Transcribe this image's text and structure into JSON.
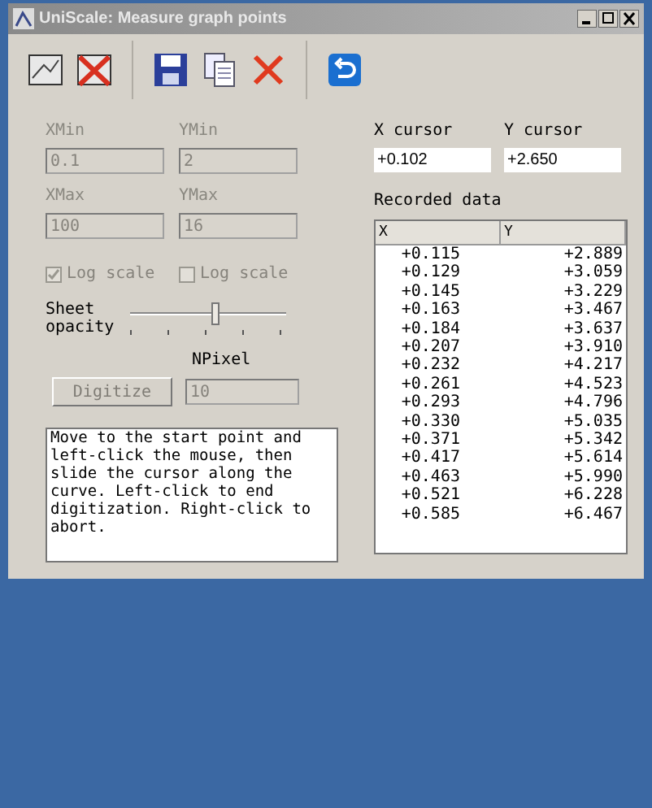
{
  "window": {
    "title": "UniScale: Measure graph points"
  },
  "axis_fields": [
    {
      "label": "XMin",
      "value": "0.1",
      "disabled": true
    },
    {
      "label": "YMin",
      "value": "2",
      "disabled": true
    },
    {
      "label": "XMax",
      "value": "100",
      "disabled": true
    },
    {
      "label": "YMax",
      "value": "16",
      "disabled": true
    }
  ],
  "log_scale": [
    {
      "label": "Log scale",
      "checked": true,
      "disabled": true
    },
    {
      "label": "Log scale",
      "checked": false,
      "disabled": true
    }
  ],
  "opacity": {
    "label": "Sheet opacity",
    "level": 0.55
  },
  "npixel": {
    "label": "NPixel",
    "value": "10",
    "disabled": true
  },
  "digitize_button": {
    "label": "Digitize",
    "disabled": true
  },
  "instructions": "Move to the start point and left-click the mouse, then slide the cursor along the curve. Left-click to end digitization. Right-click to abort.",
  "cursor_fields": [
    {
      "label": "X cursor",
      "value": "+0.102"
    },
    {
      "label": "Y cursor",
      "value": "+2.650"
    }
  ],
  "recorded_data": {
    "title": "Recorded data",
    "columns": [
      "X",
      "Y"
    ],
    "rows": [
      [
        "+0.115",
        "+2.889"
      ],
      [
        "+0.129",
        "+3.059"
      ],
      [
        "+0.145",
        "+3.229"
      ],
      [
        "+0.163",
        "+3.467"
      ],
      [
        "+0.184",
        "+3.637"
      ],
      [
        "+0.207",
        "+3.910"
      ],
      [
        "+0.232",
        "+4.217"
      ],
      [
        "+0.261",
        "+4.523"
      ],
      [
        "+0.293",
        "+4.796"
      ],
      [
        "+0.330",
        "+5.035"
      ],
      [
        "+0.371",
        "+5.342"
      ],
      [
        "+0.417",
        "+5.614"
      ],
      [
        "+0.463",
        "+5.990"
      ],
      [
        "+0.521",
        "+6.228"
      ],
      [
        "+0.585",
        "+6.467"
      ]
    ]
  }
}
